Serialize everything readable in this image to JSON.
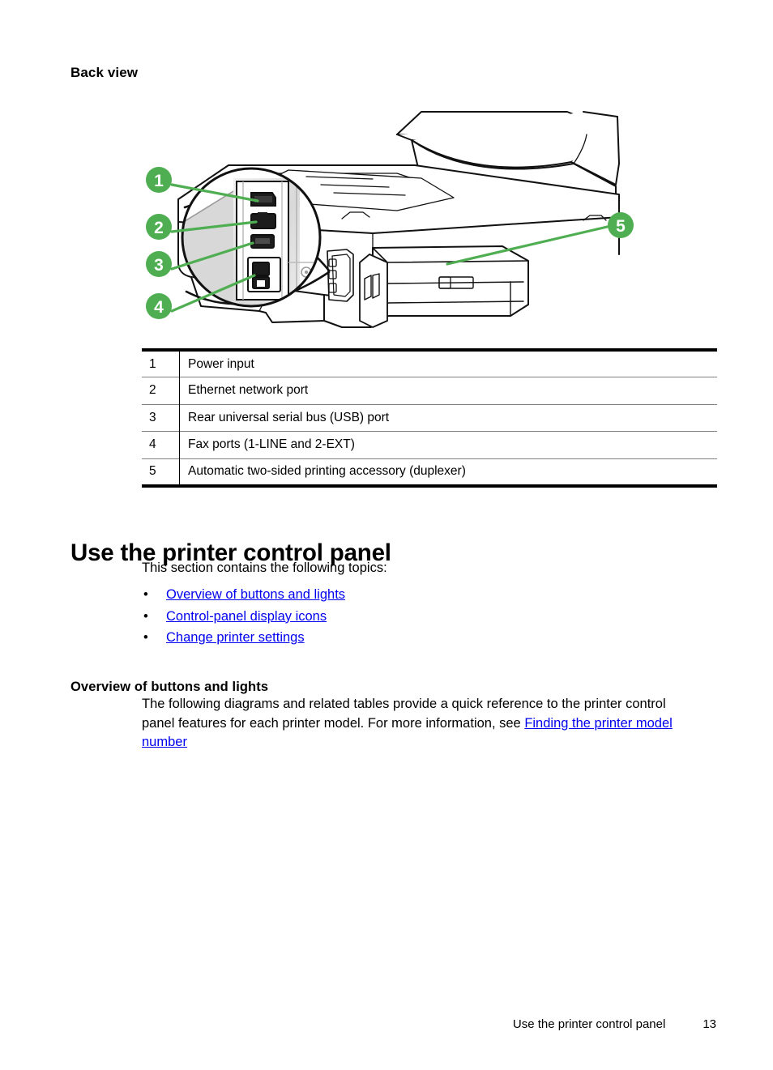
{
  "section": {
    "back_view_heading": "Back view"
  },
  "figure": {
    "name": "printer-back-view-diagram",
    "callout_color": "#4fae51",
    "line_color": "#1a1a1a",
    "callouts": [
      {
        "number": "1",
        "target": "Power input"
      },
      {
        "number": "2",
        "target": "Ethernet network port"
      },
      {
        "number": "3",
        "target": "Rear universal serial bus (USB) port"
      },
      {
        "number": "4",
        "target": "Fax ports (1-LINE and 2-EXT)"
      },
      {
        "number": "5",
        "target": "Automatic two-sided printing accessory (duplexer)"
      }
    ]
  },
  "legend_table": {
    "rows": [
      {
        "num": "1",
        "label": "Power input"
      },
      {
        "num": "2",
        "label": "Ethernet network port"
      },
      {
        "num": "3",
        "label": "Rear universal serial bus (USB) port"
      },
      {
        "num": "4",
        "label": "Fax ports (1-LINE and 2-EXT)"
      },
      {
        "num": "5",
        "label": "Automatic two-sided printing accessory (duplexer)"
      }
    ]
  },
  "main": {
    "title": "Use the printer control panel",
    "intro": "This section contains the following topics:",
    "bullet_marker": "•",
    "topics": [
      {
        "label": "Overview of buttons and lights"
      },
      {
        "label": "Control-panel display icons"
      },
      {
        "label": "Change printer settings"
      }
    ],
    "subsection": {
      "title": "Overview of buttons and lights",
      "paragraph_part1": "The following diagrams and related tables provide a quick reference to the printer control panel features for each printer model. For more information, see ",
      "paragraph_link": "Finding the printer model number"
    }
  },
  "footer": {
    "text": "Use the printer control panel",
    "page_number": "13"
  }
}
